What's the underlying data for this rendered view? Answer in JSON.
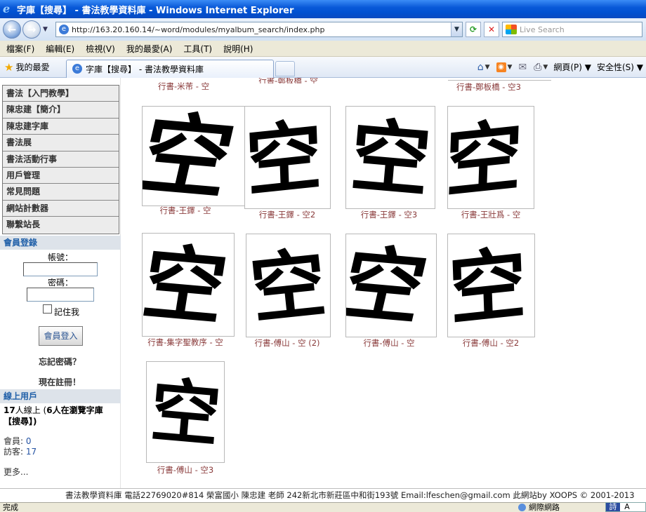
{
  "window": {
    "title": "字庫【搜尋】 - 書法教學資料庫 - Windows Internet Explorer"
  },
  "address": {
    "url": "http://163.20.160.14/~word/modules/myalbum_search/index.php"
  },
  "search": {
    "placeholder": "Live Search"
  },
  "menu": [
    "檔案(F)",
    "編輯(E)",
    "檢視(V)",
    "我的最愛(A)",
    "工具(T)",
    "說明(H)"
  ],
  "favorites": {
    "label": "我的最愛"
  },
  "tab": {
    "title": "字庫【搜尋】 - 書法教學資料庫"
  },
  "commands": {
    "page": "網頁(P)",
    "safety": "安全性(S)"
  },
  "sidebar": {
    "items": [
      "書法【入門教學】",
      "陳忠建【簡介】",
      "陳忠建字庫",
      "書法展",
      "書法活動行事",
      "用戶管理",
      "常見問題",
      "網站計數器",
      "聯繫站長"
    ],
    "login": {
      "heading": "會員登錄",
      "account_label": "帳號：",
      "password_label": "密碼：",
      "remember_label": "記住我",
      "login_button": "會員登入",
      "forgot_link": "忘記密碼？",
      "register_link": "現在註冊！"
    },
    "online": {
      "heading": "線上用戶",
      "count": "17",
      "text_online": "人線上 (",
      "browsing": "6",
      "text_browsing": "人在瀏覽字庫【搜尋】)",
      "members_label": "會員:",
      "members": "0",
      "visitors_label": "訪客:",
      "visitors": "17",
      "more": "更多..."
    }
  },
  "gallery": {
    "top_captions": [
      "行書-米芾 - 空",
      "行書-鄭板橋 - 空",
      "行書-鄭板橋 - 空3"
    ],
    "items": [
      {
        "caption": "行書-王鐸 - 空"
      },
      {
        "caption": "行書-王鐸 - 空2"
      },
      {
        "caption": "行書-王鐸 - 空3"
      },
      {
        "caption": "行書-王壯爲 - 空"
      },
      {
        "caption": "行書-集字聖教序 - 空"
      },
      {
        "caption": "行書-傅山 - 空 (2)"
      },
      {
        "caption": "行書-傅山 - 空"
      },
      {
        "caption": "行書-傅山 - 空2"
      },
      {
        "caption": "行書-傅山 - 空3"
      }
    ],
    "glyph": "空"
  },
  "footer": {
    "text": "書法教學資料庫 電話22769020#814 榮富國小 陳忠建 老師 242新北市新莊區中和街193號 Email:lfeschen@gmail.com 此網站by XOOPS © 2001-2013"
  },
  "status": {
    "left": "完成",
    "zone": "網際網路"
  },
  "ime": {
    "l1": "詩",
    "l2": "A"
  }
}
